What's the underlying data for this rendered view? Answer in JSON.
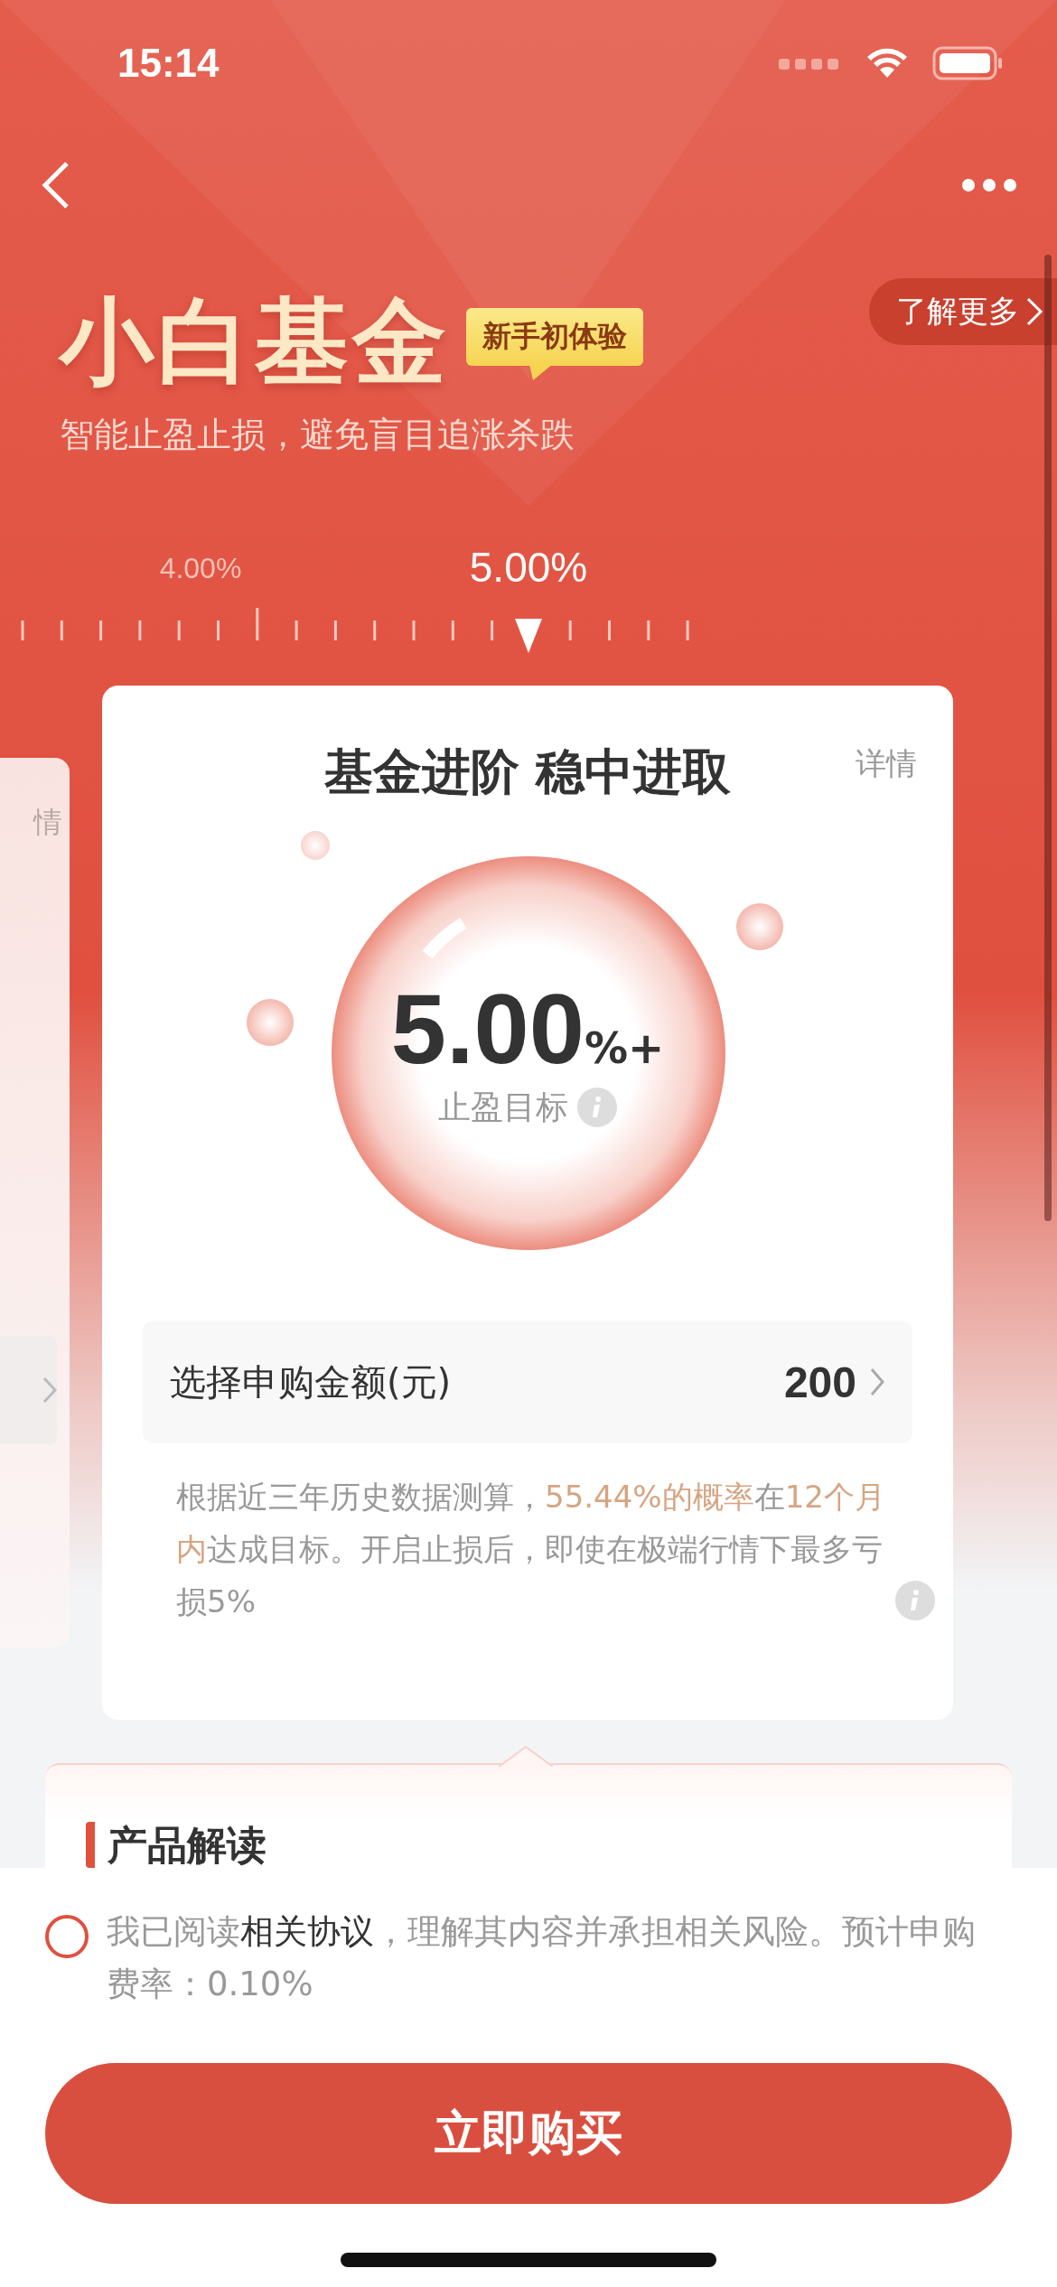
{
  "status_bar": {
    "time": "15:14"
  },
  "nav": {
    "more_link": "了解更多"
  },
  "header": {
    "title": "小白基金",
    "badge": "新手初体验",
    "subtitle": "智能止盈止损，避免盲目追涨杀跌"
  },
  "ruler": {
    "labels": [
      {
        "text": "4.00%",
        "selected": false
      },
      {
        "text": "5.00%",
        "selected": true
      }
    ]
  },
  "side_card": {
    "detail_link": "情"
  },
  "plan_card": {
    "title": "基金进阶 稳中进取",
    "detail_link": "详情",
    "target_value": "5.00",
    "target_suffix": "%+",
    "target_label": "止盈目标",
    "amount": {
      "label": "选择申购金额(元)",
      "value": "200"
    },
    "description": [
      {
        "text": "根据近三年历史数据测算，",
        "highlight": false
      },
      {
        "text": "55.44%的概率",
        "highlight": true
      },
      {
        "text": "在",
        "highlight": false
      },
      {
        "text": "12个月内",
        "highlight": true
      },
      {
        "text": "达成目标。开启止损后，即使在极端行情下最多亏损5%",
        "highlight": false
      }
    ]
  },
  "section": {
    "heading": "产品解读"
  },
  "agreement": {
    "checked": false,
    "parts": [
      {
        "text": "我已阅读",
        "link": false
      },
      {
        "text": "相关协议",
        "link": true
      },
      {
        "text": "，理解其内容并承担相关风险。预计申购费率：0.10%",
        "link": false
      }
    ]
  },
  "buy_button": "立即购买"
}
